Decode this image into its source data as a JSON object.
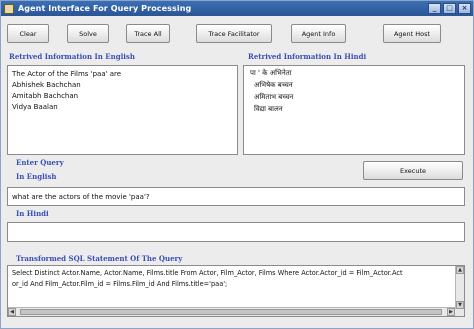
{
  "window": {
    "title": "Agent Interface For Query Processing",
    "minimize_glyph": "_",
    "maximize_glyph": "□",
    "close_glyph": "×"
  },
  "toolbar": {
    "clear_label": "Clear",
    "solve_label": "Solve",
    "trace_all_label": "Trace All",
    "trace_facilitator_label": "Trace Facilitator",
    "agent_info_label": "Agent Info",
    "agent_host_label": "Agent Host"
  },
  "english_panel": {
    "heading": "Retrived Information In English",
    "lines": [
      "The  Actor of the  Films 'paa' are",
      "  Abhishek Bachchan",
      "  Amitabh Bachchan",
      "  Vidya Baalan"
    ]
  },
  "hindi_panel": {
    "heading": "Retrived Information In Hindi",
    "lines": [
      "पा '   के अभिनेता",
      "अभिषेक  बच्चन",
      "अमिताभ  बच्चन",
      "विद्या  बालन"
    ]
  },
  "query": {
    "heading": "Enter Query",
    "english_label": "In English",
    "english_value": "what are the actors of the movie 'paa'?",
    "hindi_label": "In Hindi",
    "hindi_value": "",
    "execute_label": "Execute"
  },
  "sql": {
    "heading": "Transformed SQL Statement Of The Query",
    "lines": [
      "Select Distinct Actor.Name,  Actor.Name, Films.title From  Actor, Film_Actor, Films Where  Actor.Actor_id = Film_Actor.Act",
      "or_id And Film_Actor.Film_id = Films.Film_id And  Films.title='paa';"
    ]
  },
  "colors": {
    "titlebar": "#2f62a8",
    "label_blue": "#3a4fb8",
    "background": "#ececec"
  }
}
